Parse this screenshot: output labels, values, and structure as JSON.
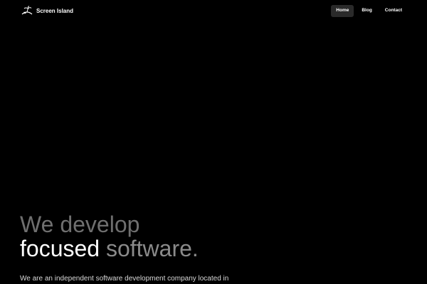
{
  "brand": {
    "name": "Screen Island",
    "logo_icon": "island-logo-icon"
  },
  "nav": {
    "items": [
      {
        "label": "Home",
        "active": true
      },
      {
        "label": "Blog",
        "active": false
      },
      {
        "label": "Contact",
        "active": false
      }
    ]
  },
  "hero": {
    "line1": "We develop",
    "line2_emphasis": "focused",
    "line2_rest": " software."
  },
  "intro": {
    "text": "We are an independent software development company located in"
  },
  "colors": {
    "background": "#000000",
    "text": "#ffffff",
    "dim_text": "#6f6f6f",
    "active_nav_bg": "#2a2a2a"
  }
}
